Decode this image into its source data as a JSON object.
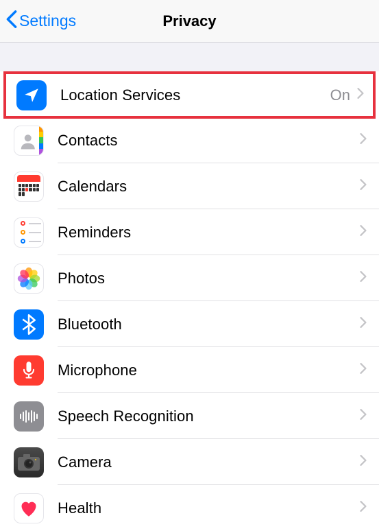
{
  "header": {
    "back_label": "Settings",
    "title": "Privacy"
  },
  "rows": {
    "location": {
      "label": "Location Services",
      "value": "On"
    },
    "contacts": {
      "label": "Contacts"
    },
    "calendars": {
      "label": "Calendars"
    },
    "reminders": {
      "label": "Reminders"
    },
    "photos": {
      "label": "Photos"
    },
    "bluetooth": {
      "label": "Bluetooth"
    },
    "microphone": {
      "label": "Microphone"
    },
    "speech": {
      "label": "Speech Recognition"
    },
    "camera": {
      "label": "Camera"
    },
    "health": {
      "label": "Health"
    }
  }
}
